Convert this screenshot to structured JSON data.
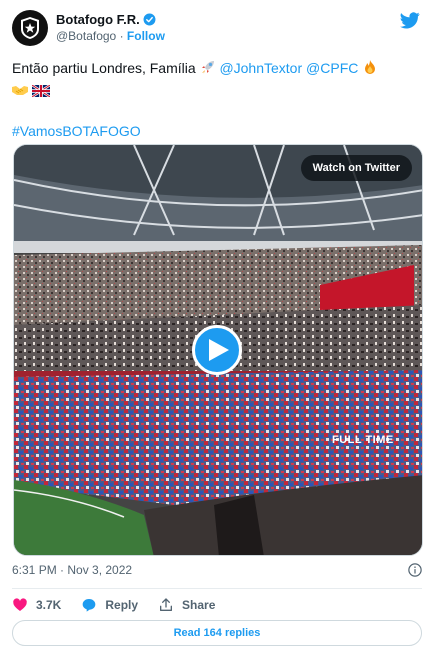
{
  "author": {
    "display_name": "Botafogo F.R.",
    "handle": "@Botafogo",
    "separator": "·",
    "follow_label": "Follow",
    "verified": true
  },
  "tweet": {
    "text_part1": "Então partiu Londres, Família ",
    "mention1": "@JohnTextor",
    "mention2": "@CPFC",
    "hashtag": "#VamosBOTAFOGO",
    "emojis": [
      "rocket",
      "fire",
      "handshake",
      "uk-flag"
    ]
  },
  "media": {
    "watch_label": "Watch on Twitter",
    "scoreboard_text": "FULL TIME"
  },
  "meta": {
    "timestamp": "6:31 PM · Nov 3, 2022"
  },
  "actions": {
    "like_count": "3.7K",
    "reply_label": "Reply",
    "share_label": "Share"
  },
  "replies_button": "Read 164 replies",
  "colors": {
    "accent": "#1d9bf0",
    "like": "#f91880",
    "text": "#0f1419",
    "muted": "#536471"
  }
}
